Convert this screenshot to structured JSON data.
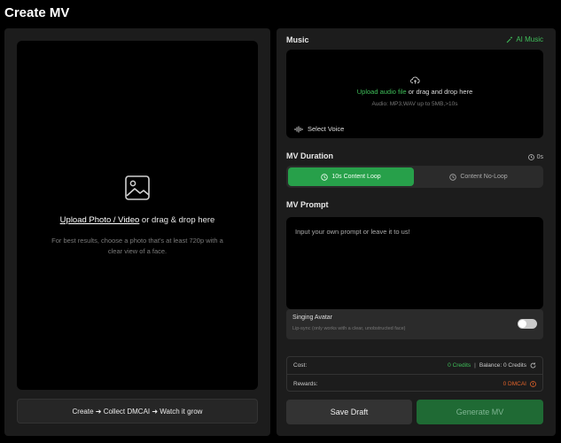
{
  "page": {
    "title": "Create MV"
  },
  "left": {
    "upload_link": "Upload Photo / Video",
    "upload_rest": " or drag & drop here",
    "upload_hint": "For best results, choose a photo that's at least 720p with a clear view of a face.",
    "promo": "Create ➜ Collect DMCAI ➜ Watch it grow"
  },
  "music": {
    "label": "Music",
    "ai_music": "AI Music",
    "upload_link": "Upload audio file",
    "upload_rest": " or drag and drop here",
    "hint": "Audio: MP3,WAV up to 5MB,>10s",
    "select_voice": "Select Voice"
  },
  "duration": {
    "label": "MV Duration",
    "readout": "0s",
    "options": [
      {
        "label": "10s Content Loop",
        "active": true
      },
      {
        "label": "Content No-Loop",
        "active": false
      }
    ]
  },
  "prompt": {
    "label": "MV Prompt",
    "placeholder": "Input your own prompt or leave it to us!"
  },
  "singing": {
    "title": "Singing Avatar",
    "desc": "Lip-sync (only works with a clear, unobstructed face)",
    "enabled": false
  },
  "cost": {
    "cost_label": "Cost:",
    "cost_value": "0 Credits",
    "balance": "Balance: 0 Credits",
    "rewards_label": "Rewards:",
    "rewards_value": "0 DMCAI"
  },
  "actions": {
    "save_draft": "Save Draft",
    "generate": "Generate MV"
  },
  "colors": {
    "accent_green": "#3fbf5a",
    "active_green": "#27a04a",
    "reward_orange": "#e0622a"
  }
}
